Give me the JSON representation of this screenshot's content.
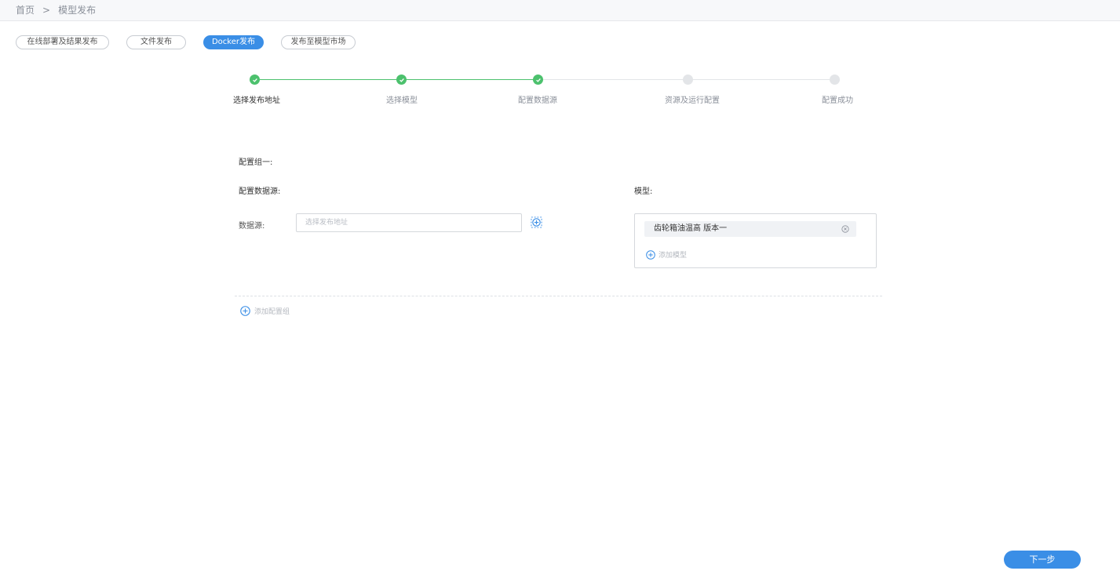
{
  "breadcrumb": {
    "home": "首页",
    "separator": ">",
    "current": "模型发布"
  },
  "publish_tabs": [
    {
      "label": "在线部署及结果发布",
      "active": false
    },
    {
      "label": "文件发布",
      "active": false
    },
    {
      "label": "Docker发布",
      "active": true
    },
    {
      "label": "发布至模型市场",
      "active": false
    }
  ],
  "steps": [
    {
      "label": "选择发布地址",
      "status": "done"
    },
    {
      "label": "选择模型",
      "status": "done"
    },
    {
      "label": "配置数据源",
      "status": "done"
    },
    {
      "label": "资源及运行配置",
      "status": "todo"
    },
    {
      "label": "配置成功",
      "status": "todo"
    }
  ],
  "config_group": {
    "title": "配置组一:",
    "datasource_section": "配置数据源:",
    "model_section": "模型:",
    "datasource_label": "数据源:",
    "datasource_placeholder": "选择发布地址",
    "model_chip": "齿轮箱油温高 版本一",
    "add_model": "添加模型"
  },
  "add_group": "添加配置组",
  "next_button": "下一步",
  "colors": {
    "primary": "#3a8ee6",
    "done": "#4cc16d",
    "todo": "#e3e5e8"
  },
  "icons": {
    "check": "check-icon",
    "target": "target-icon",
    "close": "close-circle-icon",
    "add": "plus-circle-icon"
  }
}
